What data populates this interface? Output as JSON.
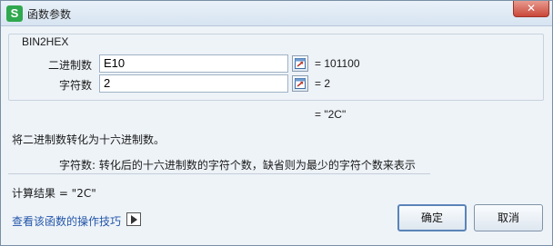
{
  "window": {
    "title": "函数参数",
    "app_icon_letter": "S"
  },
  "function": {
    "name": "BIN2HEX"
  },
  "params": [
    {
      "label": "二进制数",
      "value": "E10",
      "evaluated": "= 101100"
    },
    {
      "label": "字符数",
      "value": "2",
      "evaluated": "= 2"
    }
  ],
  "result_preview": "= \"2C\"",
  "description": "将二进制数转化为十六进制数。",
  "param_help": "字符数:   转化后的十六进制数的字符个数，缺省则为最少的字符个数来表示",
  "calc_result": "计算结果 = \"2C\"",
  "tips_link": "查看该函数的操作技巧",
  "buttons": {
    "ok": "确定",
    "cancel": "取消"
  }
}
